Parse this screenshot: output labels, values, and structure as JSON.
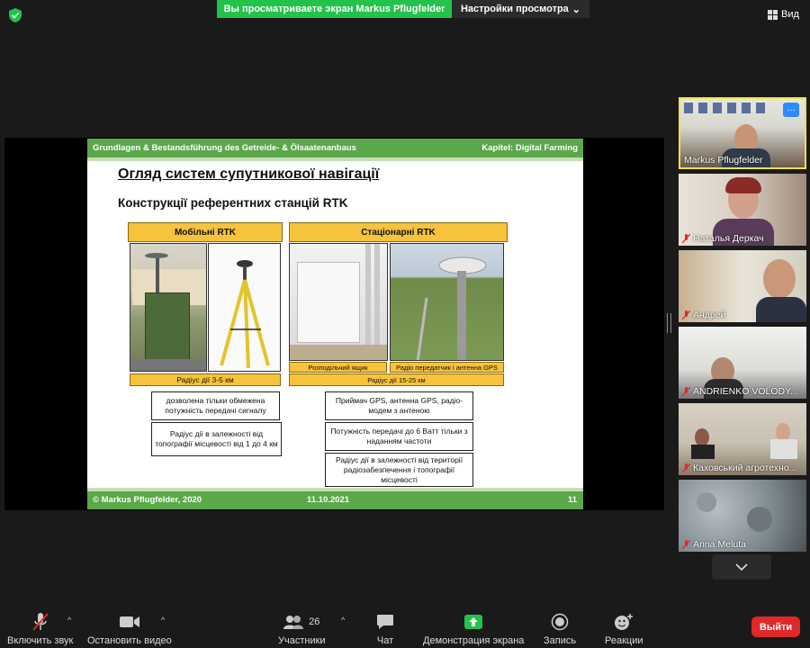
{
  "top": {
    "share_banner": "Вы просматриваете экран Markus Pflugfelder",
    "view_settings": "Настройки просмотра",
    "view_button": "Вид"
  },
  "slide": {
    "header_left": "Grundlagen & Bestandsführung des Getreide- & Ölsaatenanbaus",
    "header_right": "Kapitel: Digital Farming",
    "title": "Огляд систем супутникової навігації",
    "subtitle": "Конструкції референтних станцій RTK",
    "mobile_header": "Мобільні RTK",
    "stationary_header": "Стаціонарні RTK",
    "mobile_radius": "Радіус дії 3-5 км",
    "distribution_box": "Розподільчий ящик",
    "radio_antenna": "Радіо передатчик і антенна GPS",
    "stationary_radius": "Радіус дії 15-25 км",
    "mobile_note1": "дозволена тільки обмежена потужність передачі сигналу",
    "mobile_note2": "Радіус дії в залежності від топографії місцевості від 1 до 4 км",
    "stat_note1": "Приймач GPS, антенна GPS, радіо-модем з антеною",
    "stat_note2": "Потужність передачі до 6 Ватт тільки з наданням частоти",
    "stat_note3": "Радіус дії в залежності від території радіозабезпечення і топографії місцевості",
    "footer_left": "© Markus Pflugfelder, 2020",
    "footer_date": "11.10.2021",
    "footer_page": "11"
  },
  "participants": [
    {
      "name": "Markus Pflugfelder",
      "muted": false,
      "active": true
    },
    {
      "name": "Наталья Деркач",
      "muted": true
    },
    {
      "name": "Андрей",
      "muted": true
    },
    {
      "name": "ANDRIENKO VOLODY...",
      "muted": true
    },
    {
      "name": "Каховський агротехно...",
      "muted": true
    },
    {
      "name": "Anna Meluta",
      "muted": true
    }
  ],
  "toolbar": {
    "mute": "Включить звук",
    "video": "Остановить видео",
    "participants": "Участники",
    "participants_count": "26",
    "chat": "Чат",
    "share": "Демонстрация экрана",
    "record": "Запись",
    "reactions": "Реакции",
    "leave": "Выйти"
  },
  "colors": {
    "share_green": "#23c24b",
    "slide_green": "#5aa84a",
    "slide_yellow": "#f7c23c",
    "active_speaker": "#f6e14a",
    "leave_red": "#e02828"
  }
}
